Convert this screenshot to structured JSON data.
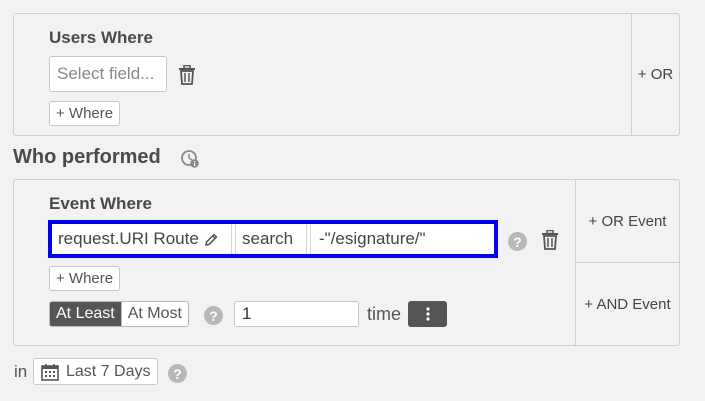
{
  "users_where": {
    "title": "Users Where",
    "field_placeholder": "Select field...",
    "add_where_label": "+ Where",
    "or_label": "+ OR"
  },
  "who_performed": {
    "title": "Who performed"
  },
  "event_where": {
    "title": "Event Where",
    "property": "request.URI Route",
    "operator": "search",
    "value": "-\"/esignature/\"",
    "add_where_label": "+ Where",
    "at_least_label": "At Least",
    "at_most_label": "At Most",
    "selected_frequency": "At Least",
    "count_value": "1",
    "time_label": "time",
    "or_event_label": "+ OR Event",
    "and_event_label": "+ AND Event"
  },
  "footer": {
    "in_label": "in",
    "date_range_label": "Last 7 Days"
  },
  "colors": {
    "highlight_border": "#0000ee",
    "toggle_active_bg": "#555555",
    "kebab_bg": "#555555",
    "help_icon": "#b8b8b8"
  },
  "icons": {
    "delete": "trash-icon",
    "edit": "pencil-icon",
    "help": "question-circle-icon",
    "info": "clock-info-icon",
    "calendar": "calendar-icon",
    "menu": "kebab-vertical-icon"
  }
}
